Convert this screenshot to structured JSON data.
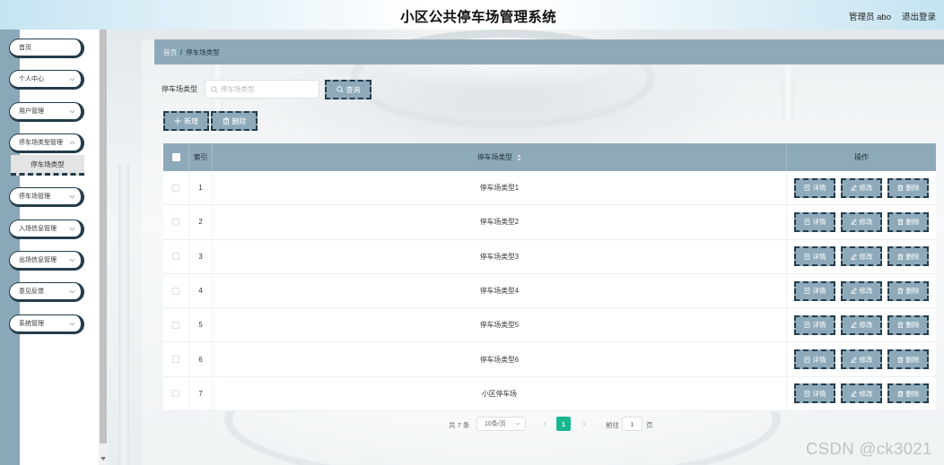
{
  "theme": {
    "primary": "#8eaaba",
    "dark_border": "#243d4c",
    "active_page": "#16b88e"
  },
  "header": {
    "title": "小区公共停车场管理系统",
    "user": "管理员 abo",
    "logout": "退出登录"
  },
  "sidebar": {
    "menu": [
      {
        "label": "首页",
        "has_children": false
      },
      {
        "label": "个人中心",
        "has_children": true
      },
      {
        "label": "用户管理",
        "has_children": true
      },
      {
        "label": "停车场类型管理",
        "has_children": true,
        "expanded": true
      },
      {
        "label": "停车场管理",
        "has_children": true
      },
      {
        "label": "入场信息管理",
        "has_children": true
      },
      {
        "label": "出场信息管理",
        "has_children": true
      },
      {
        "label": "意见反馈",
        "has_children": true
      },
      {
        "label": "系统管理",
        "has_children": true
      }
    ],
    "submenu": {
      "label": "停车场类型"
    }
  },
  "breadcrumb": {
    "home": "首页",
    "separator": "/",
    "current": "停车场类型"
  },
  "search": {
    "label": "停车场类型",
    "placeholder": "停车场类型",
    "value": "",
    "button": "查询"
  },
  "actions": {
    "add": "新增",
    "delete": "删除"
  },
  "table": {
    "header": {
      "index": "索引",
      "type": "停车场类型",
      "actions": "操作"
    },
    "rows": [
      {
        "index": "1",
        "type": "停车场类型1"
      },
      {
        "index": "2",
        "type": "停车场类型2"
      },
      {
        "index": "3",
        "type": "停车场类型3"
      },
      {
        "index": "4",
        "type": "停车场类型4"
      },
      {
        "index": "5",
        "type": "停车场类型5"
      },
      {
        "index": "6",
        "type": "停车场类型6"
      },
      {
        "index": "7",
        "type": "小区停车场"
      }
    ],
    "row_actions": {
      "detail": "详情",
      "edit": "修改",
      "delete": "删除"
    }
  },
  "pagination": {
    "total": "共 7 条",
    "page_size": "10条/页",
    "current_page": "1",
    "goto_label": "前往",
    "goto_value": "1",
    "goto_unit": "页"
  },
  "watermark": "CSDN @ck3021"
}
